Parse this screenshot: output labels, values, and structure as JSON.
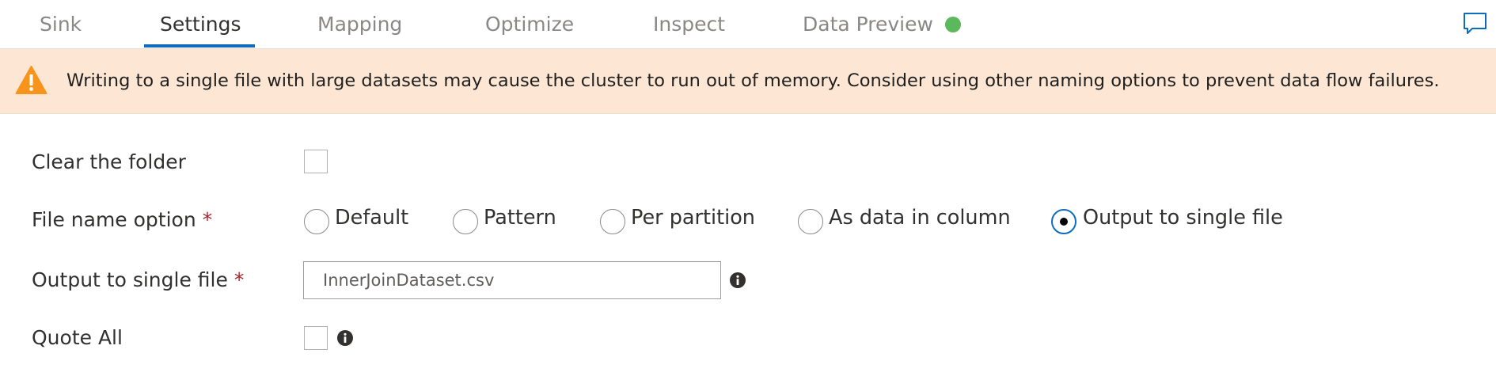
{
  "tabs": [
    {
      "label": "Sink"
    },
    {
      "label": "Settings"
    },
    {
      "label": "Mapping"
    },
    {
      "label": "Optimize"
    },
    {
      "label": "Inspect"
    },
    {
      "label": "Data Preview"
    }
  ],
  "active_tab": "Settings",
  "data_preview_status_color": "#5cb85c",
  "accent_color": "#0f6cbd",
  "warning": {
    "icon": "warning-triangle-icon",
    "text": "Writing to a single file with large datasets may cause the cluster to run out of memory. Consider using other naming options to prevent data flow failures."
  },
  "form": {
    "clear_folder": {
      "label": "Clear the folder",
      "checked": false
    },
    "file_name_option": {
      "label": "File name option",
      "required_mark": "*",
      "options": [
        {
          "label": "Default",
          "selected": false
        },
        {
          "label": "Pattern",
          "selected": false
        },
        {
          "label": "Per partition",
          "selected": false
        },
        {
          "label": "As data in column",
          "selected": false
        },
        {
          "label": "Output to single file",
          "selected": true
        }
      ]
    },
    "output_single_file": {
      "label": "Output to single file",
      "required_mark": "*",
      "value": "InnerJoinDataset.csv"
    },
    "quote_all": {
      "label": "Quote All",
      "checked": false
    }
  }
}
